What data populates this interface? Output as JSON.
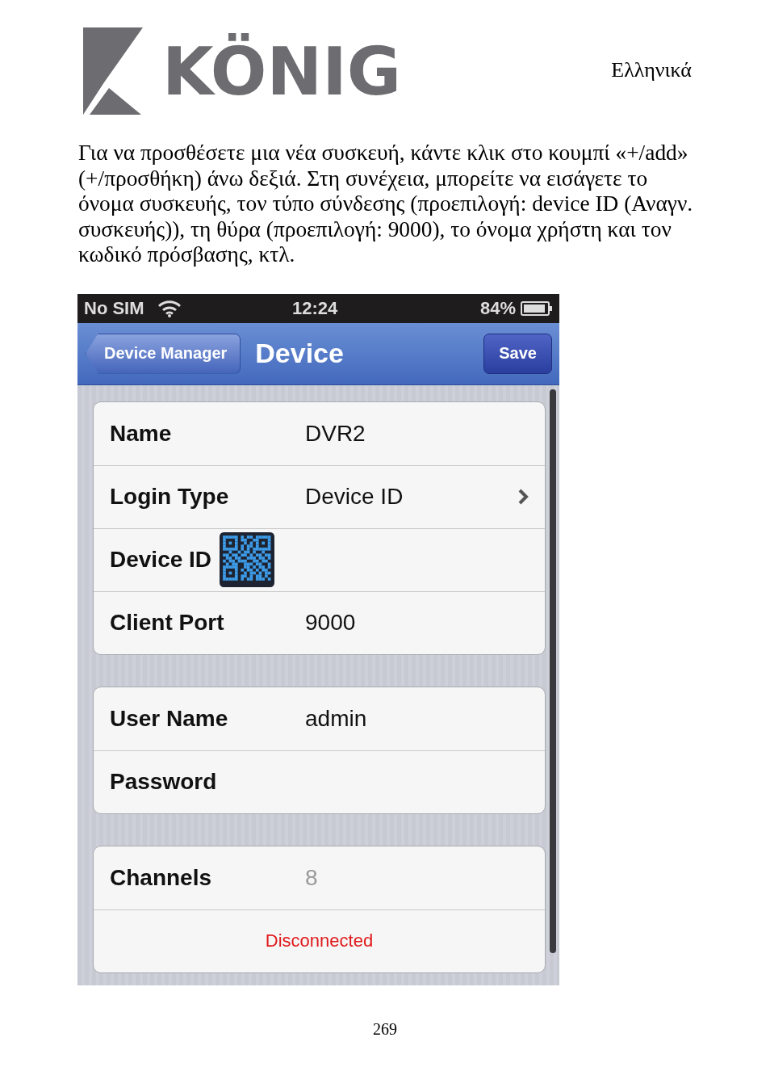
{
  "header": {
    "logo_text": "KÖNIG",
    "language": "Ελληνικά"
  },
  "intro": "Για να προσθέσετε μια νέα συσκευή, κάντε κλικ στο κουμπί «+/add» (+/προσθήκη) άνω δεξιά. Στη συνέχεια, μπορείτε να εισάγετε το όνομα συσκευής, τον τύπο σύνδεσης (προεπιλογή: device ID (Αναγν. συσκευής)), τη θύρα (προεπιλογή: 9000), το όνομα χρήστη και τον κωδικό πρόσβασης, κτλ.",
  "phone": {
    "status_bar": {
      "carrier": "No SIM",
      "time": "12:24",
      "battery": "84%"
    },
    "nav_bar": {
      "back": "Device Manager",
      "title": "Device",
      "action": "Save"
    },
    "groups": [
      {
        "rows": [
          {
            "kind": "field",
            "label": "Name",
            "value": "DVR2"
          },
          {
            "kind": "picker",
            "label": "Login Type",
            "value": "Device ID"
          },
          {
            "kind": "qr",
            "label": "Device ID"
          },
          {
            "kind": "field",
            "label": "Client Port",
            "value": "9000"
          }
        ]
      },
      {
        "rows": [
          {
            "kind": "field",
            "label": "User Name",
            "value": "admin"
          },
          {
            "kind": "field",
            "label": "Password"
          }
        ]
      },
      {
        "rows": [
          {
            "kind": "readonly",
            "label": "Channels",
            "value": "8"
          },
          {
            "kind": "status",
            "value": "Disconnected"
          }
        ]
      }
    ]
  },
  "page_number": "269"
}
